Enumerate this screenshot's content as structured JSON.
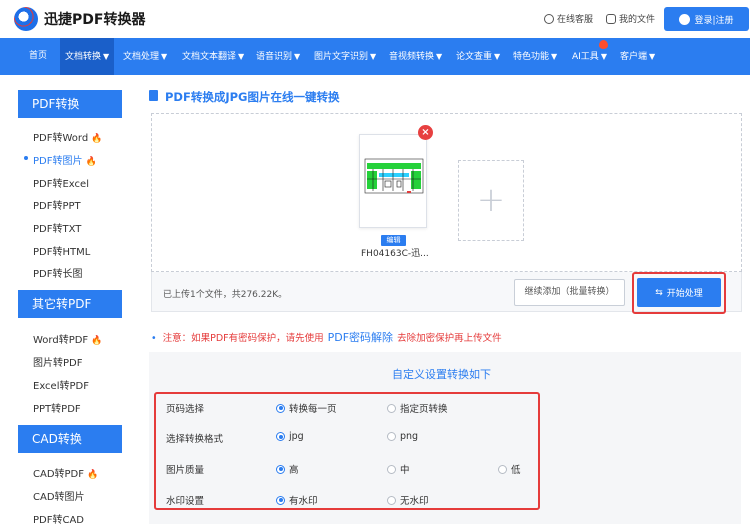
{
  "header": {
    "brand": "迅捷PDF转换器",
    "service_label": "在线客服",
    "my_files_label": "我的文件",
    "login_label": "登录|注册"
  },
  "nav": {
    "items": [
      {
        "label": "首页"
      },
      {
        "label": "文档转换"
      },
      {
        "label": "文档处理"
      },
      {
        "label": "文档文本翻译"
      },
      {
        "label": "语音识别"
      },
      {
        "label": "图片文字识别"
      },
      {
        "label": "音视频转换"
      },
      {
        "label": "论文查重"
      },
      {
        "label": "特色功能"
      },
      {
        "label": "AI工具"
      },
      {
        "label": "客户端"
      }
    ],
    "new_badge": "新"
  },
  "sidebar": {
    "sections": [
      {
        "title": "PDF转换",
        "items": [
          "PDF转Word",
          "PDF转图片",
          "PDF转Excel",
          "PDF转PPT",
          "PDF转TXT",
          "PDF转HTML",
          "PDF转长图"
        ]
      },
      {
        "title": "其它转PDF",
        "items": [
          "Word转PDF",
          "图片转PDF",
          "Excel转PDF",
          "PPT转PDF"
        ]
      },
      {
        "title": "CAD转换",
        "items": [
          "CAD转PDF",
          "CAD转图片",
          "PDF转CAD"
        ]
      }
    ]
  },
  "main": {
    "title": "PDF转换成JPG图片在线一键转换",
    "file": {
      "edit_label": "编辑",
      "name": "FH04163C-迅..."
    },
    "status_text": "已上传1个文件，共276.22K。",
    "continue_label": "继续添加（批量转换）",
    "start_label": "开始处理",
    "notice_prefix": "注意：如果PDF有密码保护，请先使用",
    "notice_link": "PDF密码解除",
    "notice_suffix": "去除加密保护再上传文件",
    "settings_title": "自定义设置转换如下",
    "settings": {
      "page": {
        "label": "页码选择",
        "opt1": "转换每一页",
        "opt2": "指定页转换"
      },
      "format": {
        "label": "选择转换格式",
        "opt1": "jpg",
        "opt2": "png"
      },
      "quality": {
        "label": "图片质量",
        "opt1": "高",
        "opt2": "中",
        "opt3": "低"
      },
      "watermark": {
        "label": "水印设置",
        "opt1": "有水印",
        "opt2": "无水印"
      }
    }
  },
  "colors": {
    "accent": "#2b7df0",
    "alert": "#e53b3b"
  }
}
